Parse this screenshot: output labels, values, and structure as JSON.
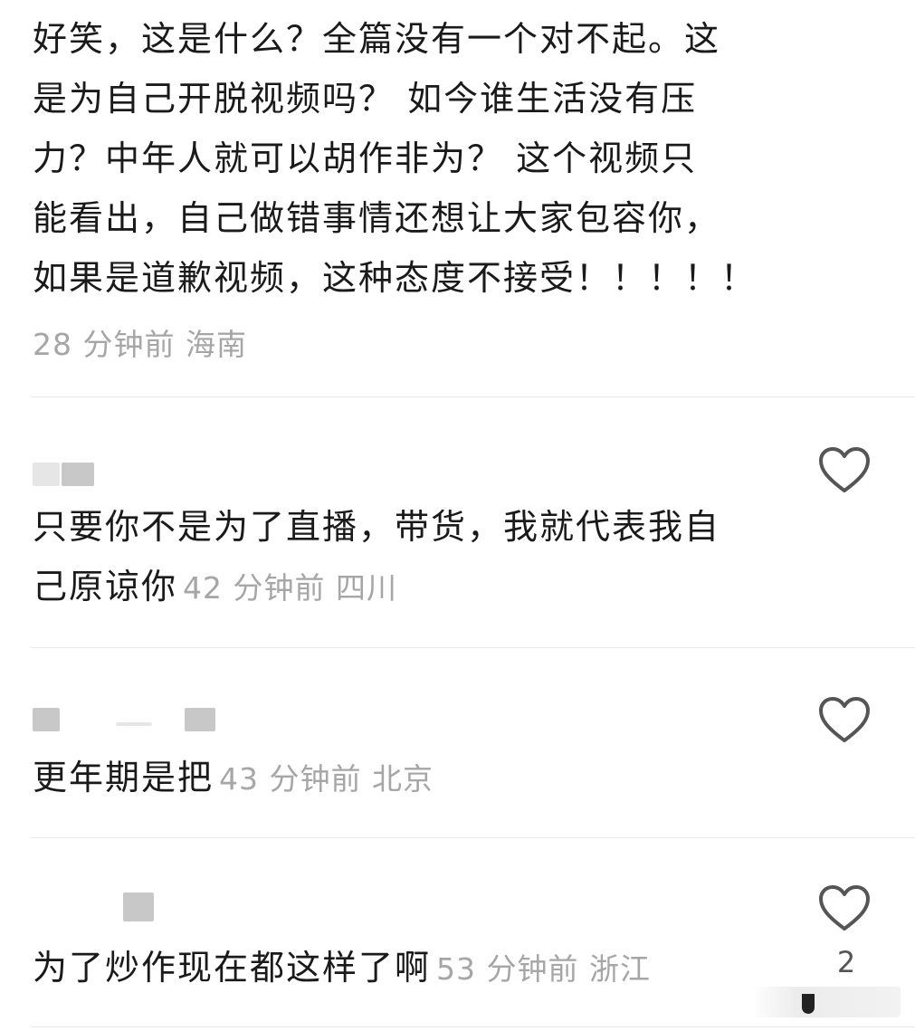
{
  "comments": [
    {
      "text": "好笑，这是什么？全篇没有一个对不起。这是为自己开脱视频吗？ 如今谁生活没有压力？中年人就可以胡作非为？  这个视频只能看出，自己做错事情还想让大家包容你，如果是道歉视频，这种态度不接受！！！！！",
      "lines": [
        "好笑，这是什么？全篇没有一个对不起。这",
        "是为自己开脱视频吗？ 如今谁生活没有压",
        "力？中年人就可以胡作非为？  这个视频只",
        "能看出，自己做错事情还想让大家包容你，",
        "如果是道歉视频，这种态度不接受！！！！！"
      ],
      "meta": "28 分钟前 海南"
    },
    {
      "text_line1": "只要你不是为了直播，带货，我就代表我自",
      "text_line2": "己原谅你",
      "meta": "42 分钟前 四川",
      "like_icon": "heart-outline-icon"
    },
    {
      "text": "更年期是把",
      "meta": "43 分钟前 北京",
      "like_icon": "heart-outline-icon"
    },
    {
      "text": "为了炒作现在都这样了啊",
      "meta": "53 分钟前 浙江",
      "like_icon": "heart-outline-icon",
      "like_count": "2"
    }
  ],
  "colors": {
    "text": "#1a1a1a",
    "meta": "#a6a6a6",
    "divider": "#e8e8e8",
    "icon": "#555555"
  }
}
